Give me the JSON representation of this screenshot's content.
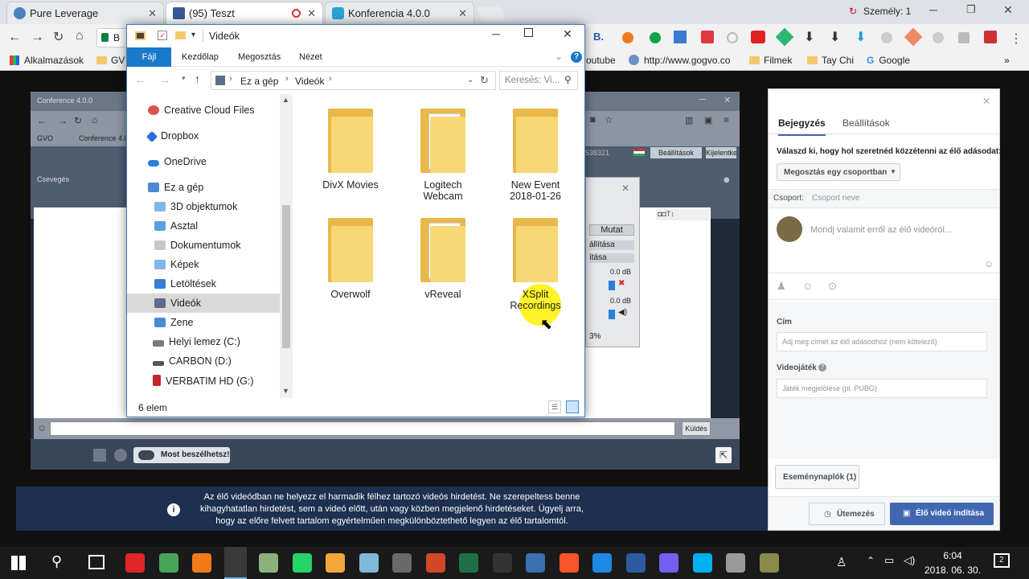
{
  "browser": {
    "tabs": [
      {
        "title": "Pure Leverage",
        "fav_color": "#4a7fc1"
      },
      {
        "title": "(95) Teszt",
        "fav_color": "#3b5998"
      },
      {
        "title": "Konferencia 4.0.0",
        "fav_color": "#29a3d6"
      }
    ],
    "profile_label": "Személy: 1",
    "address_prefix": "B",
    "bookmarks": [
      "Alkalmazások",
      "GV",
      "outube",
      "http://www.gogvo.co",
      "Filmek",
      "Tay Chi",
      "Google"
    ],
    "more_label": "»"
  },
  "conference": {
    "window_title": "Conference 4.0.0",
    "bookmarks": [
      "GVO",
      "Conference 4.0"
    ],
    "chat_label": "Csevegés",
    "header_buttons": [
      "Beállítások",
      "Kijelentkezés"
    ],
    "id_fragment": "538321",
    "mute_label": "Mutat",
    "setting_rows": [
      "állítása",
      "ítása"
    ],
    "db_values": [
      "0.0 dB",
      "0.0 dB"
    ],
    "percent": "3%",
    "send_label": "Küldés",
    "talk_label": "Most beszélhetsz!"
  },
  "explorer": {
    "title": "Videók",
    "ribbon_tabs": [
      "Fájl",
      "Kezdőlap",
      "Megosztás",
      "Nézet"
    ],
    "path": [
      "Ez a gép",
      "Videók"
    ],
    "search_placeholder": "Keresés: Vi...",
    "nav_items": [
      {
        "label": "Creative Cloud Files",
        "color": "#d9534f"
      },
      {
        "label": "Dropbox",
        "color": "#2d6bd6"
      },
      {
        "label": "OneDrive",
        "color": "#2a7fd6"
      },
      {
        "label": "Ez a gép",
        "color": "#4a8ad6"
      },
      {
        "label": "3D objektumok",
        "color": "#7fb8e8"
      },
      {
        "label": "Asztal",
        "color": "#5aa0e0"
      },
      {
        "label": "Dokumentumok",
        "color": "#c9c9c9"
      },
      {
        "label": "Képek",
        "color": "#7fb8e8"
      },
      {
        "label": "Letöltések",
        "color": "#3a7bd5"
      },
      {
        "label": "Videók",
        "color": "#5a6e8c"
      },
      {
        "label": "Zene",
        "color": "#4a8ad6"
      },
      {
        "label": "Helyi lemez (C:)",
        "color": "#7a7a7a"
      },
      {
        "label": "CARBON (D:)",
        "color": "#555555"
      },
      {
        "label": "VERBATIM HD (G:)",
        "color": "#c0282d"
      }
    ],
    "folders": [
      {
        "name": "DivX Movies",
        "type": "plain"
      },
      {
        "name": "Logitech Webcam",
        "type": "docs"
      },
      {
        "name": "New Event 2018-01-26",
        "type": "plain"
      },
      {
        "name": "Overwolf",
        "type": "plain"
      },
      {
        "name": "vReveal",
        "type": "docs"
      },
      {
        "name": "XSplit Recordings",
        "type": "plain"
      }
    ],
    "status": "6 elem"
  },
  "facebook": {
    "tabs": [
      "Bejegyzés",
      "Beállítások"
    ],
    "share_prompt": "Válaszd ki, hogy hol szeretnéd közzétenni az élő adásodat:",
    "share_dropdown": "Megosztás egy csoportban",
    "group_label": "Csoport:",
    "group_placeholder": "Csoport neve",
    "post_placeholder": "Mondj valamit erről az élő videóról...",
    "title_label": "Cím",
    "title_placeholder": "Adj meg címet az élő adásodhoz (nem kötelező)",
    "game_label": "Videojáték",
    "game_placeholder": "Játék megjelölése (pl. PUBG)",
    "events_label": "Eseménynaplók (1)",
    "schedule_label": "Ütemezés",
    "start_label": "Élő videó indítása"
  },
  "notice": {
    "line1": "Az élő videódban ne helyezz el harmadik félhez tartozó videós hirdetést. Ne szerepeltess benne",
    "line2": "kihagyhatatlan hirdetést, sem a videó előtt, után vagy közben megjelenő hirdetéseket. Ügyelj arra,",
    "line3": "hogy az előre felvett tartalom egyértelműen megkülönböztethető legyen az élő tartalomtól."
  },
  "taskbar": {
    "time": "6:04",
    "date": "2018. 06. 30.",
    "notification_count": "2",
    "icons": [
      {
        "name": "opera-icon",
        "color": "#e0262b"
      },
      {
        "name": "chrome-icon",
        "color": "#4aa35a"
      },
      {
        "name": "firefox-icon",
        "color": "#f07a1a"
      },
      {
        "name": "explorer-icon",
        "color": "#f3c96a"
      },
      {
        "name": "app-icon",
        "color": "#8bb27a"
      },
      {
        "name": "whatsapp-icon",
        "color": "#25d366"
      },
      {
        "name": "paint-icon",
        "color": "#f2a73b"
      },
      {
        "name": "box-icon",
        "color": "#7fb8d8"
      },
      {
        "name": "calculator-icon",
        "color": "#6a6a6a"
      },
      {
        "name": "powerpoint-icon",
        "color": "#d24726"
      },
      {
        "name": "excel-icon",
        "color": "#1e7145"
      },
      {
        "name": "tool-icon",
        "color": "#333333"
      },
      {
        "name": "globe-icon",
        "color": "#3a6fb0"
      },
      {
        "name": "brave-icon",
        "color": "#fb542b"
      },
      {
        "name": "edge-icon",
        "color": "#1e88e5"
      },
      {
        "name": "wifi-app-icon",
        "color": "#2d5aa0"
      },
      {
        "name": "viber-icon",
        "color": "#7360f2"
      },
      {
        "name": "skype-icon",
        "color": "#00aff0"
      },
      {
        "name": "disk-icon",
        "color": "#9a9a9a"
      },
      {
        "name": "network-tool-icon",
        "color": "#8a8a4a"
      }
    ]
  }
}
